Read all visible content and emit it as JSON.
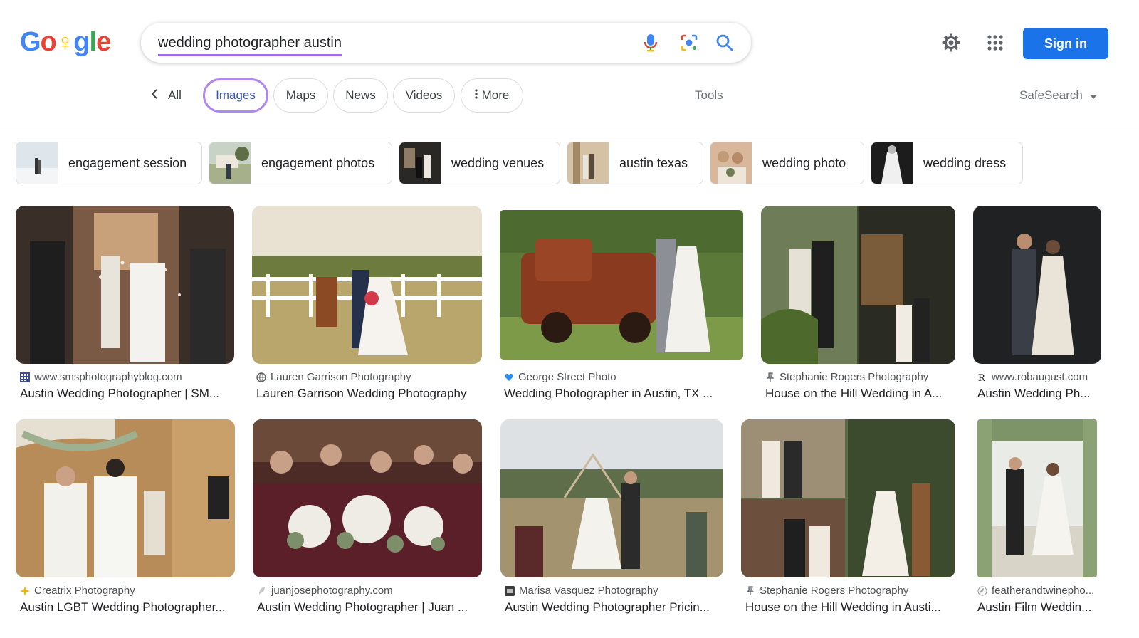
{
  "search": {
    "query": "wedding photographer austin"
  },
  "header": {
    "logo_letters": [
      "G",
      "o",
      "♀",
      "g",
      "l",
      "e"
    ],
    "sign_in_label": "Sign in"
  },
  "tabs": {
    "all_label": "All",
    "items": [
      {
        "label": "Images",
        "active": true
      },
      {
        "label": "Maps",
        "active": false
      },
      {
        "label": "News",
        "active": false
      },
      {
        "label": "Videos",
        "active": false
      },
      {
        "label": "More",
        "active": false
      }
    ],
    "tools_label": "Tools",
    "safesearch_label": "SafeSearch"
  },
  "related": [
    {
      "label": "engagement session",
      "thumb_colors": [
        "#c7d3dc",
        "#f1f3f4",
        "#3a3a3a"
      ]
    },
    {
      "label": "engagement photos",
      "thumb_colors": [
        "#7d8f63",
        "#d9d2c0",
        "#5b6a44"
      ]
    },
    {
      "label": "wedding venues",
      "thumb_colors": [
        "#2b2a28",
        "#8c7b6a",
        "#eae6df"
      ]
    },
    {
      "label": "austin texas",
      "thumb_colors": [
        "#b89b76",
        "#e9dcc7",
        "#5f4c3a"
      ]
    },
    {
      "label": "wedding photo",
      "thumb_colors": [
        "#c9a384",
        "#ece0d2",
        "#6f7d55"
      ]
    },
    {
      "label": "wedding dress",
      "thumb_colors": [
        "#1d1d1d",
        "#f2f2f2",
        "#777777"
      ]
    }
  ],
  "results": [
    {
      "source": "www.smsphotographyblog.com",
      "title": "Austin Wedding Photographer | SM...",
      "favicon": "grid"
    },
    {
      "source": "Lauren Garrison Photography",
      "title": "Lauren Garrison Wedding Photography",
      "favicon": "globe"
    },
    {
      "source": "George Street Photo",
      "title": "Wedding Photographer in Austin, TX ...",
      "favicon": "heart"
    },
    {
      "source": "Stephanie Rogers Photography",
      "title": "House on the Hill Wedding in A...",
      "favicon": "pin"
    },
    {
      "source": "www.robaugust.com",
      "title": "Austin Wedding Ph...",
      "favicon": "r"
    },
    {
      "source": "Creatrix Photography",
      "title": "Austin LGBT Wedding Photographer...",
      "favicon": "star"
    },
    {
      "source": "juanjosephotography.com",
      "title": "Austin Wedding Photographer | Juan ...",
      "favicon": "feather"
    },
    {
      "source": "Marisa Vasquez Photography",
      "title": "Austin Wedding Photographer Pricin...",
      "favicon": "square"
    },
    {
      "source": "Stephanie Rogers Photography",
      "title": "House on the Hill Wedding in Austi...",
      "favicon": "pin"
    },
    {
      "source": "featherandtwinepho...",
      "title": "Austin Film Weddin...",
      "favicon": "feather-circle"
    }
  ],
  "colors": {
    "accent": "#1a73e8",
    "active_tab_border": "#b186f1",
    "query_underline": "#a26be8"
  }
}
